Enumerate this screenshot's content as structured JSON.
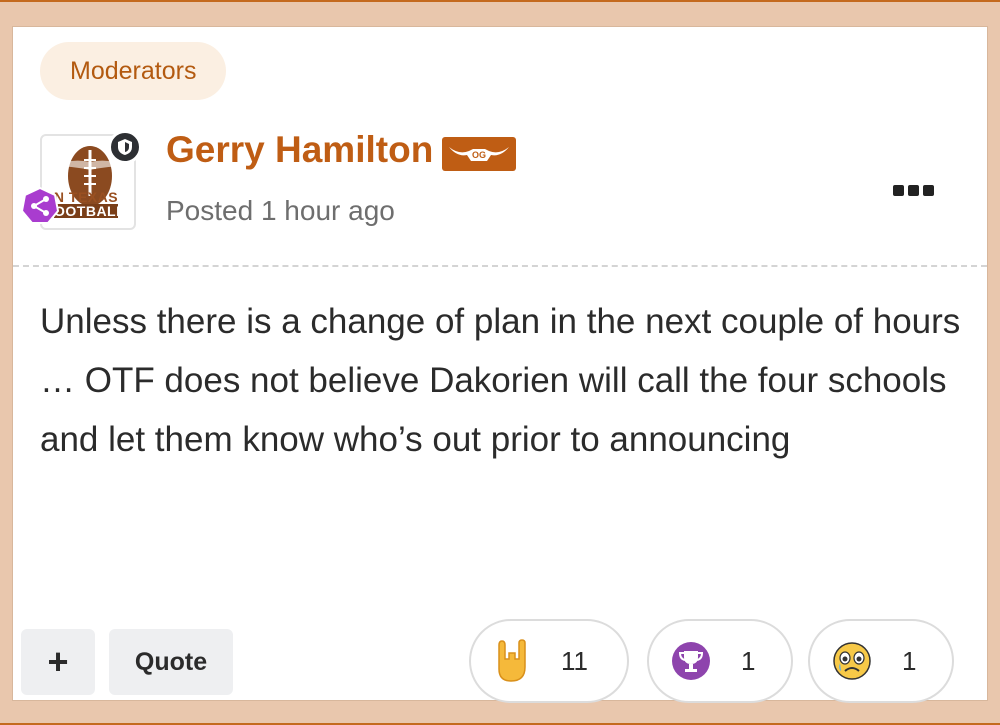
{
  "post": {
    "group_badge": "Moderators",
    "author": "Gerry Hamilton",
    "author_badge": "OG",
    "posted": "Posted 1 hour ago",
    "avatar_text_line1": "N TEXAS",
    "avatar_text_line2": "OOTBALL",
    "body": "Unless there is a change of plan in the next couple of hours … OTF does not believe Dakorien will call the four schools and let them know who’s out prior to announcing"
  },
  "actions": {
    "plus_label": "+",
    "quote_label": "Quote"
  },
  "reactions": [
    {
      "icon": "rock-on-hand-icon",
      "count": "11"
    },
    {
      "icon": "trophy-icon",
      "count": "1"
    },
    {
      "icon": "crying-face-icon",
      "count": "1"
    }
  ],
  "colors": {
    "accent": "#bf5d14",
    "badge_bg": "#fbefe2",
    "frame": "#e9c7ad",
    "share_purple": "#a93ccf",
    "trophy_purple": "#8e44ad"
  }
}
